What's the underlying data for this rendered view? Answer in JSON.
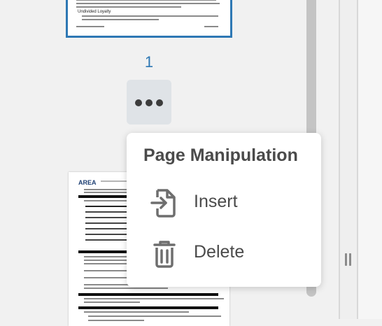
{
  "thumbnails": {
    "current_page_number": "1",
    "selected_page": {
      "bullet": "Undivided Loyalty"
    },
    "next_page": {
      "logo_text": "AREA"
    }
  },
  "context_menu": {
    "title": "Page Manipulation",
    "items": [
      {
        "label": "Insert",
        "icon": "insert-page-icon"
      },
      {
        "label": "Delete",
        "icon": "trash-icon"
      }
    ]
  },
  "colors": {
    "accent": "#2e78b4",
    "text": "#4a4a4a",
    "icon": "#6e6e6e"
  }
}
